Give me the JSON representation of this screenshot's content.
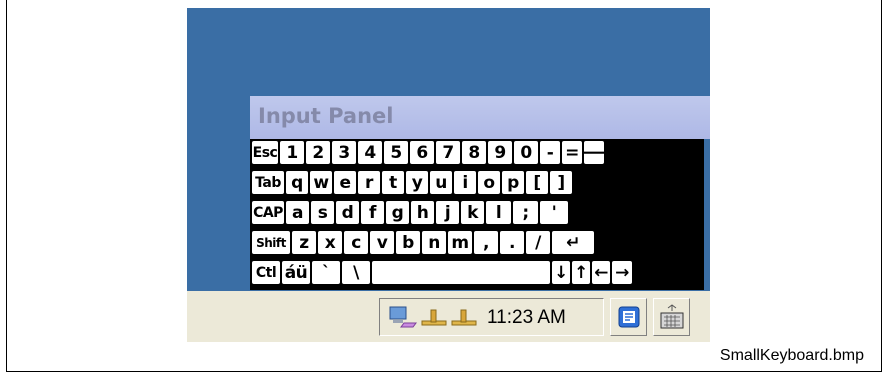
{
  "figure": {
    "caption": "SmallKeyboard.bmp"
  },
  "input_panel": {
    "title": "Input Panel"
  },
  "keyboard": {
    "rows": [
      [
        {
          "label": "Esc",
          "name": "key-esc"
        },
        {
          "label": "1",
          "name": "key-1"
        },
        {
          "label": "2",
          "name": "key-2"
        },
        {
          "label": "3",
          "name": "key-3"
        },
        {
          "label": "4",
          "name": "key-4"
        },
        {
          "label": "5",
          "name": "key-5"
        },
        {
          "label": "6",
          "name": "key-6"
        },
        {
          "label": "7",
          "name": "key-7"
        },
        {
          "label": "8",
          "name": "key-8"
        },
        {
          "label": "9",
          "name": "key-9"
        },
        {
          "label": "0",
          "name": "key-0"
        },
        {
          "label": "-",
          "name": "key-minus"
        },
        {
          "label": "=",
          "name": "key-equals"
        },
        {
          "label": "🡐",
          "name": "key-backspace"
        }
      ],
      [
        {
          "label": "Tab",
          "name": "key-tab"
        },
        {
          "label": "q",
          "name": "key-q"
        },
        {
          "label": "w",
          "name": "key-w"
        },
        {
          "label": "e",
          "name": "key-e"
        },
        {
          "label": "r",
          "name": "key-r"
        },
        {
          "label": "t",
          "name": "key-t"
        },
        {
          "label": "y",
          "name": "key-y"
        },
        {
          "label": "u",
          "name": "key-u"
        },
        {
          "label": "i",
          "name": "key-i"
        },
        {
          "label": "o",
          "name": "key-o"
        },
        {
          "label": "p",
          "name": "key-p"
        },
        {
          "label": "[",
          "name": "key-left-bracket"
        },
        {
          "label": "]",
          "name": "key-right-bracket"
        }
      ],
      [
        {
          "label": "CAP",
          "name": "key-caps"
        },
        {
          "label": "a",
          "name": "key-a"
        },
        {
          "label": "s",
          "name": "key-s"
        },
        {
          "label": "d",
          "name": "key-d"
        },
        {
          "label": "f",
          "name": "key-f"
        },
        {
          "label": "g",
          "name": "key-g"
        },
        {
          "label": "h",
          "name": "key-h"
        },
        {
          "label": "j",
          "name": "key-j"
        },
        {
          "label": "k",
          "name": "key-k"
        },
        {
          "label": "l",
          "name": "key-l"
        },
        {
          "label": ";",
          "name": "key-semicolon"
        },
        {
          "label": "'",
          "name": "key-apostrophe"
        }
      ],
      [
        {
          "label": "Shift",
          "name": "key-shift"
        },
        {
          "label": "z",
          "name": "key-z"
        },
        {
          "label": "x",
          "name": "key-x"
        },
        {
          "label": "c",
          "name": "key-c"
        },
        {
          "label": "v",
          "name": "key-v"
        },
        {
          "label": "b",
          "name": "key-b"
        },
        {
          "label": "n",
          "name": "key-n"
        },
        {
          "label": "m",
          "name": "key-m"
        },
        {
          "label": ",",
          "name": "key-comma"
        },
        {
          "label": ".",
          "name": "key-period"
        },
        {
          "label": "/",
          "name": "key-slash"
        },
        {
          "label": "↵",
          "name": "key-enter"
        }
      ],
      [
        {
          "label": "Ctl",
          "name": "key-ctrl"
        },
        {
          "label": "áü",
          "name": "key-international"
        },
        {
          "label": "`",
          "name": "key-backtick"
        },
        {
          "label": "\\",
          "name": "key-backslash"
        },
        {
          "label": "",
          "name": "key-space"
        },
        {
          "label": "↓",
          "name": "key-down"
        },
        {
          "label": "↑",
          "name": "key-up"
        },
        {
          "label": "←",
          "name": "key-left"
        },
        {
          "label": "→",
          "name": "key-right"
        }
      ]
    ]
  },
  "taskbar": {
    "clock": "11:23 AM",
    "tray_icons": [
      "network-computer-icon",
      "usb-connection-icon",
      "usb-connection-icon"
    ],
    "buttons": [
      "desktop-switch-icon",
      "keyboard-icon"
    ]
  }
}
